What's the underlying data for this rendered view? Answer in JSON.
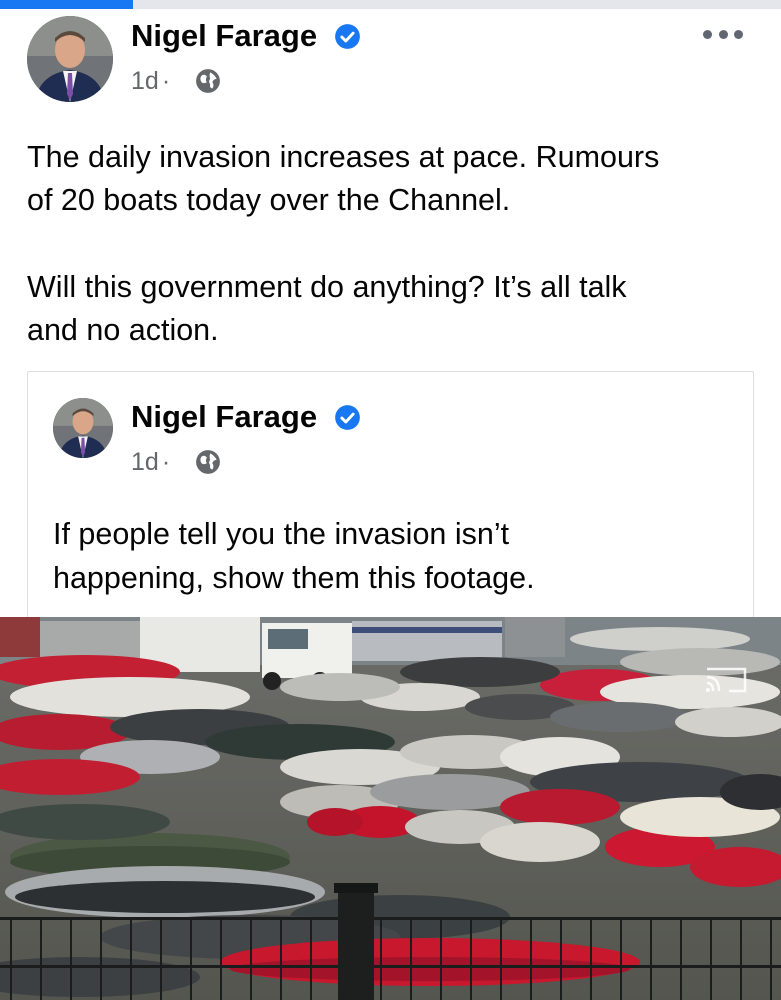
{
  "progress": {
    "fraction": 0.17,
    "color": "#1877f2"
  },
  "post": {
    "author": "Nigel Farage",
    "timestamp": "1d",
    "dot": "·",
    "text_line1": "The daily invasion increases at pace. Rumours",
    "text_line2": "of 20 boats today over the Channel.",
    "text_line3": "Will this government do anything? It’s all talk",
    "text_line4": "and no action."
  },
  "shared": {
    "author": "Nigel Farage",
    "timestamp": "1d",
    "dot": "·",
    "text_line1": "If people tell you the invasion isn’t",
    "text_line2": "happening, show them this footage."
  },
  "colors": {
    "verified_blue": "#1877f2",
    "meta_gray": "#65676b",
    "card_border": "#dadde1"
  },
  "icons": {
    "verified": "verified-badge-icon",
    "privacy": "globe-icon",
    "more": "more-options-icon",
    "cast": "cast-icon"
  }
}
